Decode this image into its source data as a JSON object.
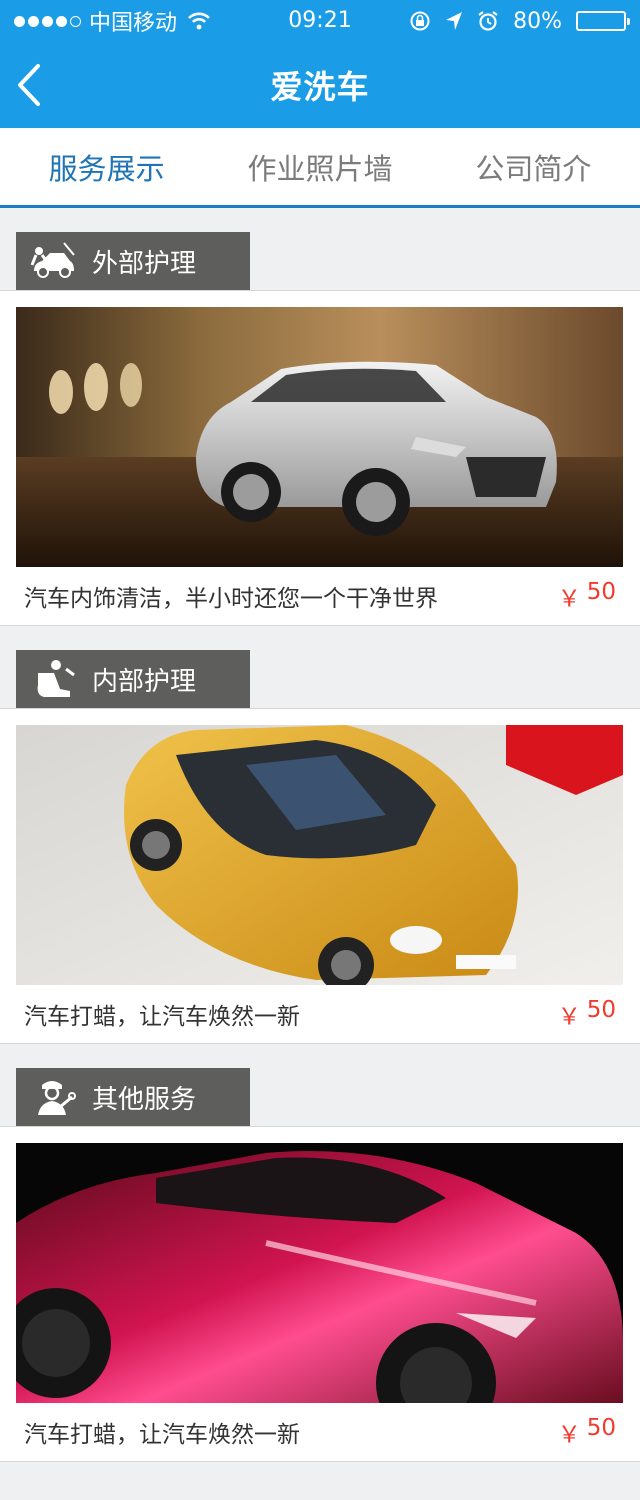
{
  "status_bar": {
    "carrier": "中国移动",
    "time": "09:21",
    "battery_text": "80%",
    "battery_level": 0.8,
    "signal_bars_filled": 4,
    "signal_bars_total": 5
  },
  "nav": {
    "title": "爱洗车"
  },
  "tabs": [
    {
      "label": "服务展示",
      "active": true
    },
    {
      "label": "作业照片墙",
      "active": false
    },
    {
      "label": "公司简介",
      "active": false
    }
  ],
  "sections": [
    {
      "title": "外部护理",
      "icon": "car-wash-icon",
      "desc": "汽车内饰清洁，半小时还您一个干净世界",
      "currency": "￥",
      "price": "50",
      "image": "silver-hatchback-photo"
    },
    {
      "title": "内部护理",
      "icon": "car-seat-icon",
      "desc": "汽车打蜡，让汽车焕然一新",
      "currency": "￥",
      "price": "50",
      "image": "yellow-compact-car-photo"
    },
    {
      "title": "其他服务",
      "icon": "mechanic-icon",
      "desc": "汽车打蜡，让汽车焕然一新",
      "currency": "￥",
      "price": "50",
      "image": "red-concept-car-photo"
    }
  ],
  "colors": {
    "brand": "#1a9de6",
    "tab_active": "#1f74b5",
    "price": "#f03b2e",
    "section_header": "#5e5e5c"
  }
}
